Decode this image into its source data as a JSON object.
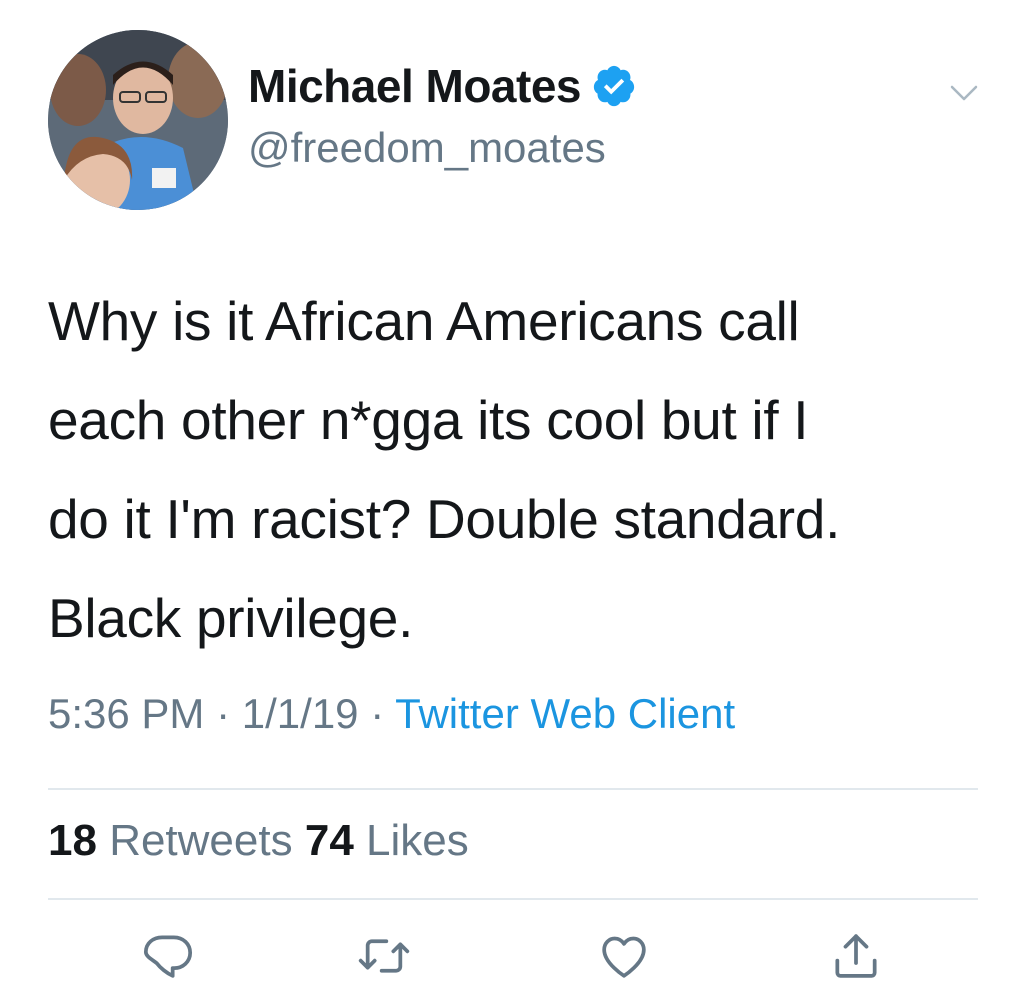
{
  "author": {
    "display_name": "Michael Moates",
    "handle": "@freedom_moates",
    "verified": true
  },
  "tweet": {
    "lines": [
      "Why is it African Americans call",
      "each other n*gga its cool but if I",
      "do it I'm racist? Double standard.",
      "Black privilege."
    ]
  },
  "meta": {
    "time": "5:36 PM",
    "separator": "·",
    "date": "1/1/19",
    "source": "Twitter Web Client"
  },
  "stats": {
    "retweets_count": "18",
    "retweets_label": "Retweets",
    "likes_count": "74",
    "likes_label": "Likes"
  },
  "icons": {
    "more": "chevron-down-icon",
    "reply": "reply-icon",
    "retweet": "retweet-icon",
    "like": "heart-icon",
    "share": "share-icon",
    "verified": "verified-badge-icon"
  },
  "colors": {
    "text": "#14171a",
    "secondary": "#657786",
    "link": "#1b95e0",
    "verified": "#1da1f2",
    "divider": "#e1e8ed"
  }
}
